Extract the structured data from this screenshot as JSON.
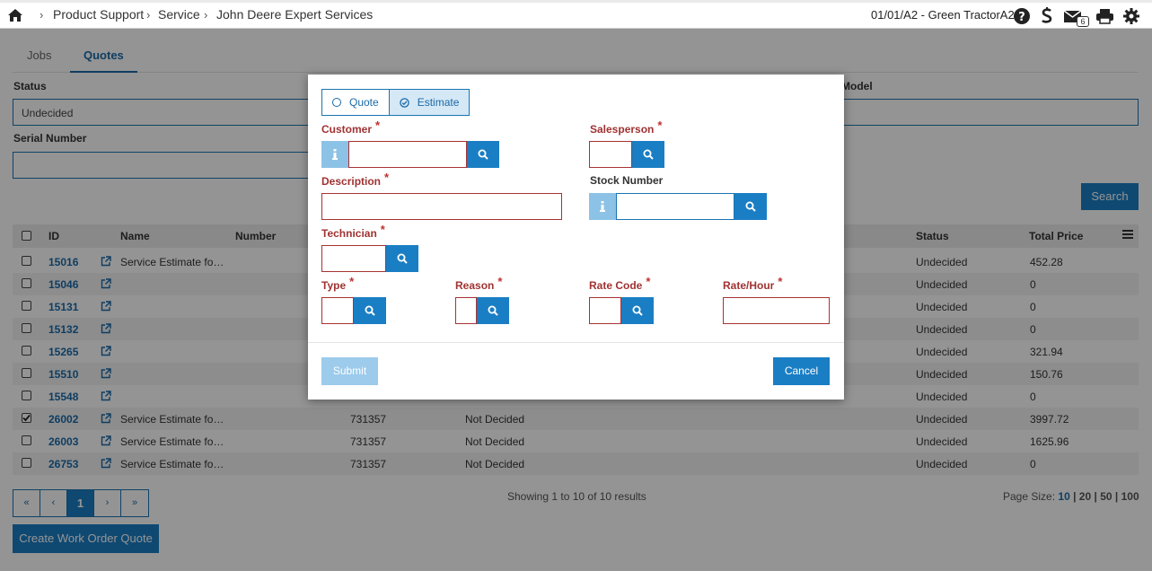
{
  "header": {
    "breadcrumbs": [
      "Product Support",
      "Service",
      "John Deere Expert Services"
    ],
    "dealer": "01/01/A2 - Green TractorA2",
    "mail_count": "6"
  },
  "tabs": [
    {
      "label": "Jobs",
      "active": false
    },
    {
      "label": "Quotes",
      "active": true
    }
  ],
  "filters": {
    "status_label": "Status",
    "status_value": "Undecided",
    "serial_label": "Serial Number",
    "serial_value": "",
    "model_label": "Model",
    "search_label": "Search"
  },
  "table": {
    "columns": [
      "ID",
      "Name",
      "Number",
      "Status",
      "Total Price"
    ],
    "rows": [
      {
        "checked": false,
        "id": "15016",
        "name": "Service Estimate fo…",
        "number": "",
        "decision": "",
        "status": "Undecided",
        "total": "452.28"
      },
      {
        "checked": false,
        "id": "15046",
        "name": "",
        "number": "",
        "decision": "",
        "status": "Undecided",
        "total": "0"
      },
      {
        "checked": false,
        "id": "15131",
        "name": "",
        "number": "",
        "decision": "",
        "status": "Undecided",
        "total": "0"
      },
      {
        "checked": false,
        "id": "15132",
        "name": "",
        "number": "",
        "decision": "",
        "status": "Undecided",
        "total": "0"
      },
      {
        "checked": false,
        "id": "15265",
        "name": "",
        "number": "",
        "decision": "",
        "status": "Undecided",
        "total": "321.94"
      },
      {
        "checked": false,
        "id": "15510",
        "name": "",
        "number": "",
        "decision": "",
        "status": "Undecided",
        "total": "150.76"
      },
      {
        "checked": false,
        "id": "15548",
        "name": "",
        "number": "",
        "decision": "",
        "status": "Undecided",
        "total": "0"
      },
      {
        "checked": true,
        "id": "26002",
        "name": "Service Estimate fo…",
        "number": "731357",
        "decision": "Not Decided",
        "status": "Undecided",
        "total": "3997.72"
      },
      {
        "checked": false,
        "id": "26003",
        "name": "Service Estimate fo…",
        "number": "731357",
        "decision": "Not Decided",
        "status": "Undecided",
        "total": "1625.96"
      },
      {
        "checked": false,
        "id": "26753",
        "name": "Service Estimate fo…",
        "number": "731357",
        "decision": "Not Decided",
        "status": "Undecided",
        "total": "0"
      }
    ]
  },
  "pagination": {
    "first": "«",
    "prev": "‹",
    "current": "1",
    "next": "›",
    "last": "»",
    "showing": "Showing 1 to 10 of 10 results",
    "page_size_label": "Page Size:",
    "page_sizes": [
      "10",
      "20",
      "50",
      "100"
    ],
    "page_size_sep": "|"
  },
  "create_button": "Create Work Order Quote",
  "modal": {
    "toggle": {
      "quote": "Quote",
      "estimate": "Estimate",
      "selected": "Estimate"
    },
    "required_mark": "*",
    "customer_label": "Customer",
    "salesperson_label": "Salesperson",
    "description_label": "Description",
    "stock_number_label": "Stock Number",
    "technician_label": "Technician",
    "type_label": "Type",
    "reason_label": "Reason",
    "rate_code_label": "Rate Code",
    "rate_hour_label": "Rate/Hour",
    "submit": "Submit",
    "cancel": "Cancel"
  },
  "colors": {
    "accent": "#1a7ec4",
    "required": "#a03232",
    "info": "#8cc2e6"
  }
}
